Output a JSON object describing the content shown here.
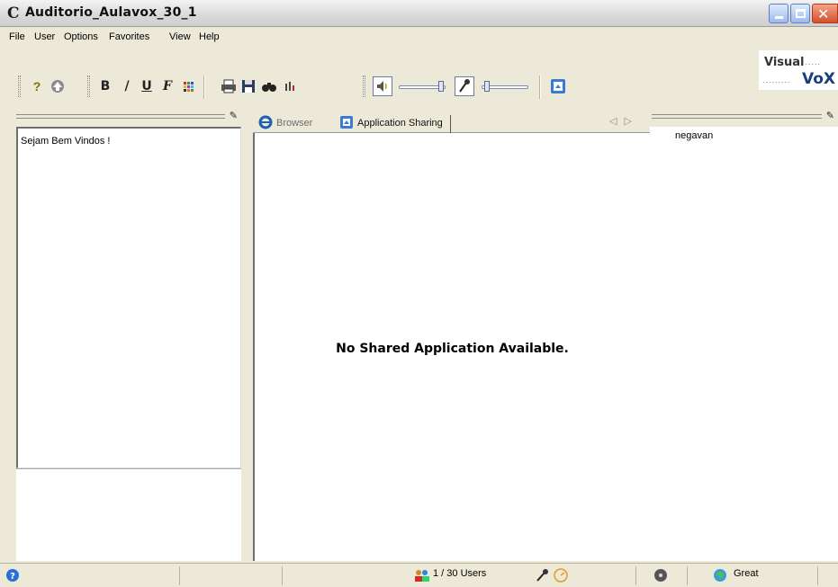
{
  "window": {
    "title": "Auditorio_Aulavox_30_1"
  },
  "menu": {
    "items": [
      "File",
      "User",
      "Options",
      "Favorites",
      "View",
      "Help"
    ]
  },
  "logo": {
    "line1": "Visual",
    "line2": "VoX"
  },
  "toolbar": {
    "bold_label": "B",
    "italic_label": "/",
    "underline_label": "U",
    "font_label": "F"
  },
  "chat": {
    "welcome_message": "Sejam Bem Vindos !"
  },
  "tabs": [
    {
      "label": "Browser",
      "active": false
    },
    {
      "label": "Application Sharing",
      "active": true
    }
  ],
  "content": {
    "message": "No Shared Application Available."
  },
  "users": {
    "list": [
      "negavan"
    ]
  },
  "status": {
    "users_count": "1 / 30 Users",
    "connection_quality": "Great"
  },
  "colors": {
    "titlebar_bg": "#e3e3e3",
    "accent_blue": "#1f5fb8",
    "close_red": "#d4502b"
  }
}
